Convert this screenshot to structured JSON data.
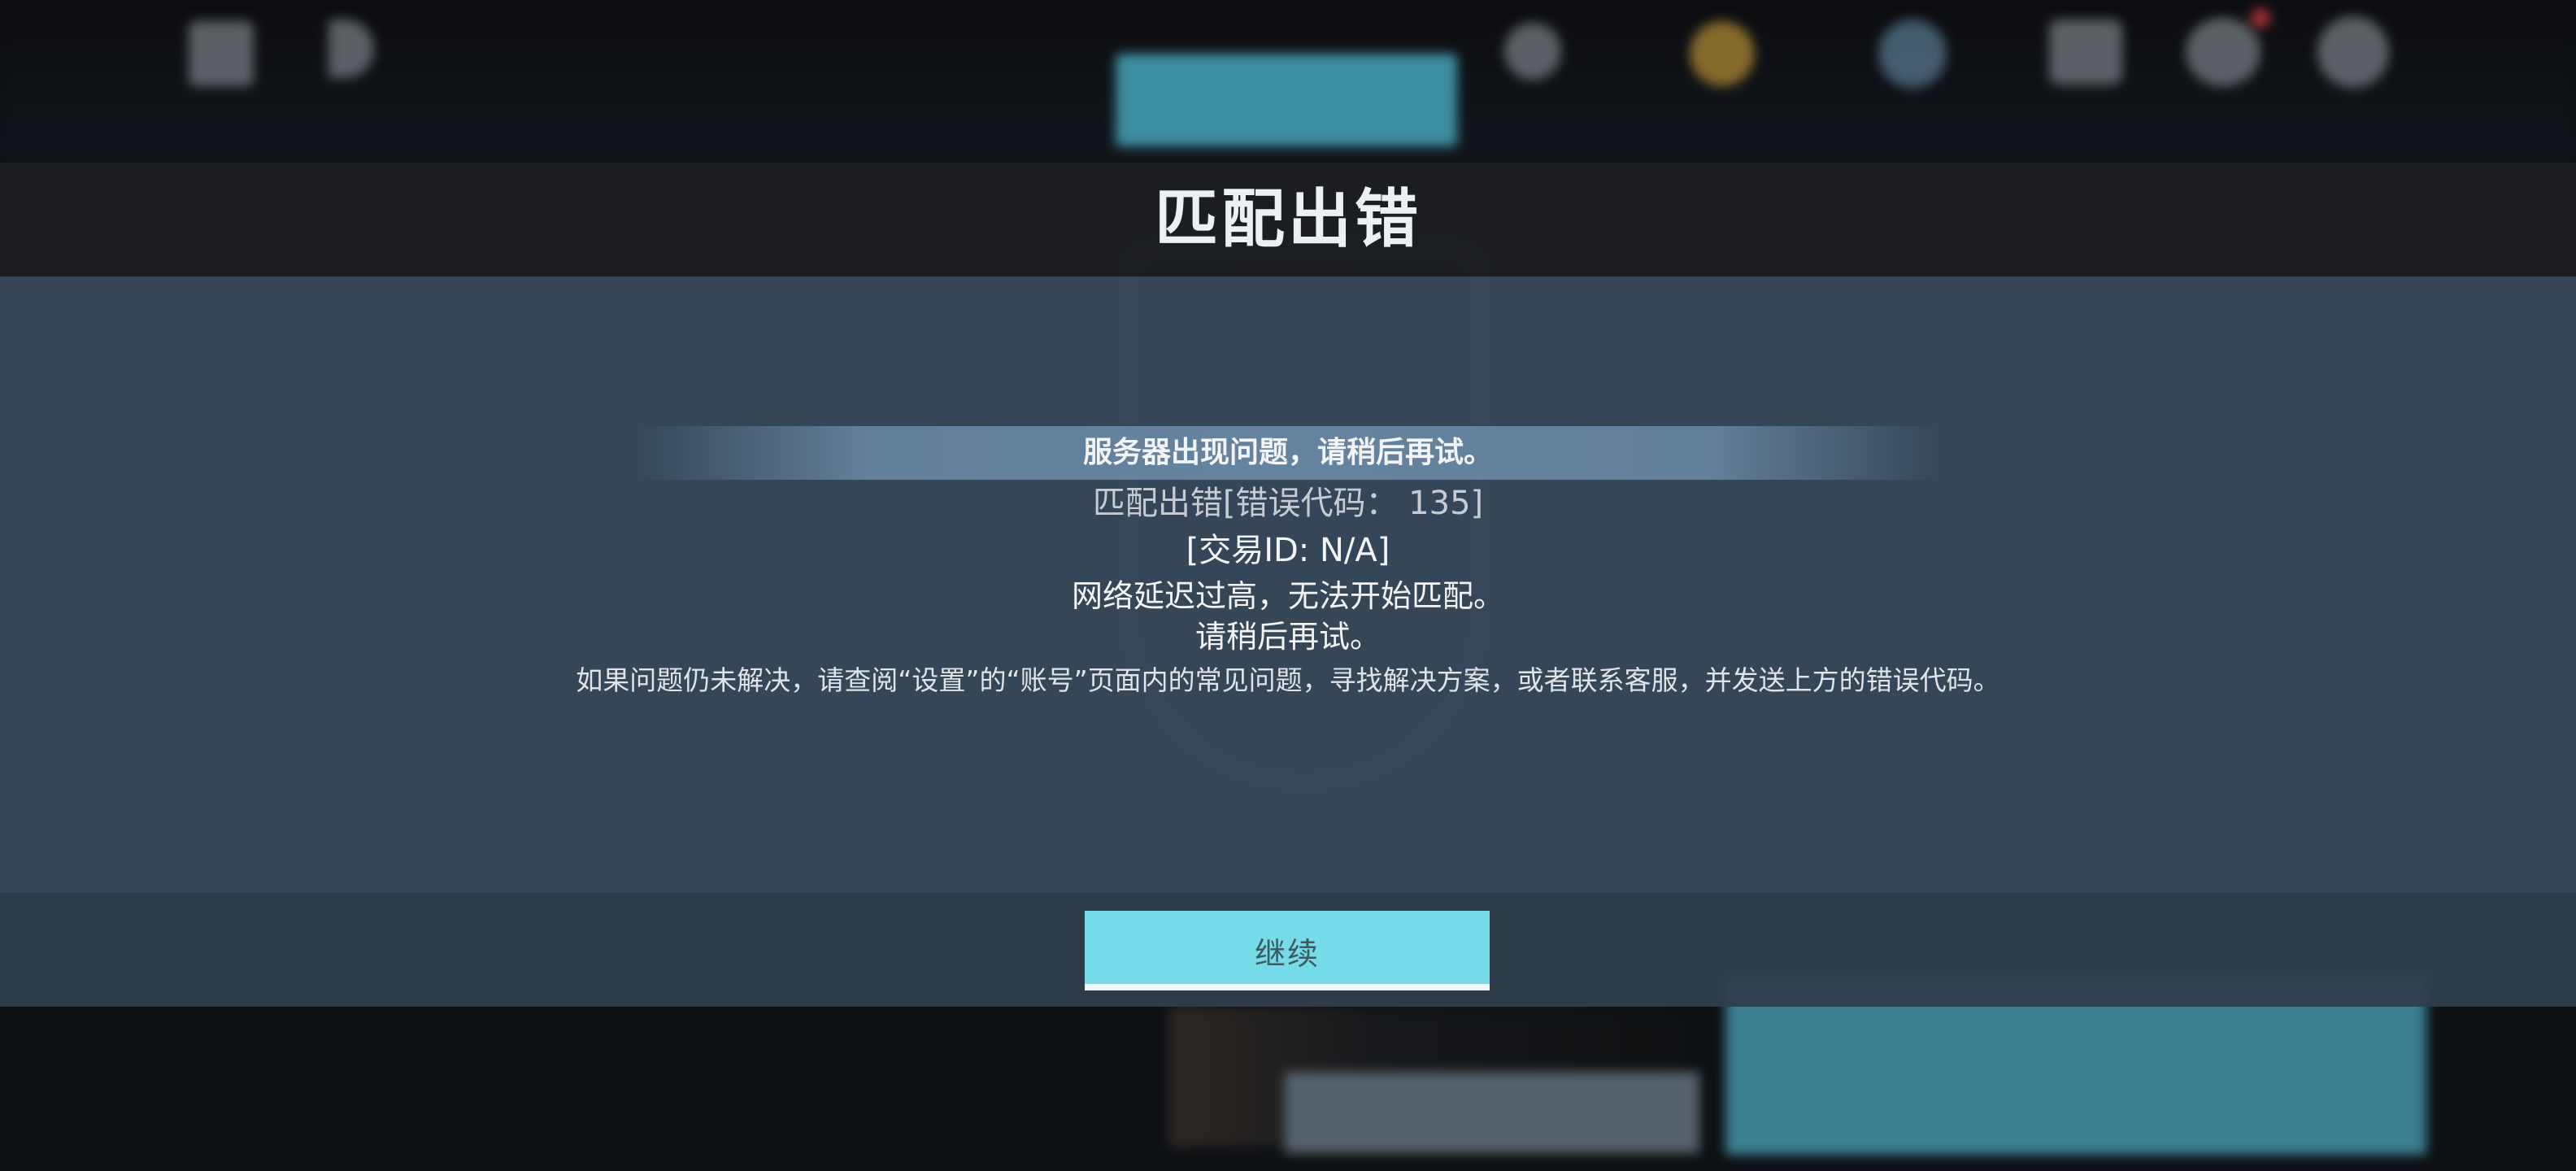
{
  "dialog": {
    "title": "匹配出错",
    "headline": "服务器出现问题，请稍后再试。",
    "error_line": "匹配出错[错误代码： 135]",
    "transaction_line": "[交易ID: N/A]",
    "network_line": "网络延迟过高，无法开始匹配。",
    "retry_line": "请稍后再试。",
    "help_line": "如果问题仍未解决，请查阅“设置”的“账号”页面内的常见问题，寻找解决方案，或者联系客服，并发送上方的错误代码。",
    "continue_label": "继续"
  },
  "colors": {
    "accent": "#76dbe8",
    "panel": "#384a5c",
    "header": "#1c1e22"
  }
}
